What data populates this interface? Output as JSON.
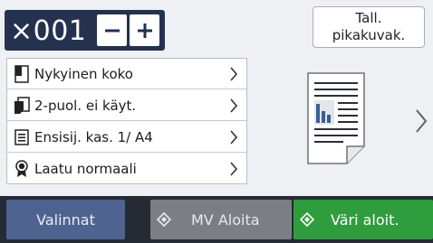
{
  "copies": {
    "value": "×001",
    "minus_label": "−",
    "plus_label": "+"
  },
  "shortcut": {
    "line1": "Tall.",
    "line2": "pikakuvak."
  },
  "settings": [
    {
      "label": "Nykyinen koko",
      "icon": "page-size-icon"
    },
    {
      "label": "2-puol. ei käyt.",
      "icon": "duplex-icon"
    },
    {
      "label": "Ensisij. kas. 1/ A4",
      "icon": "tray-icon"
    },
    {
      "label": "Laatu normaali",
      "icon": "quality-ribbon-icon"
    }
  ],
  "preview": {
    "icon": "document-preview-icon"
  },
  "bottom": {
    "options_label": "Valinnat",
    "mono_start_label": "MV Aloita",
    "color_start_label": "Väri aloit."
  },
  "colors": {
    "counter_bg": "#24324f",
    "options_bg": "#4f6391",
    "mono_bg": "#7b7e84",
    "color_bg": "#2f9d3e",
    "bottom_bar_bg": "#262a33"
  }
}
